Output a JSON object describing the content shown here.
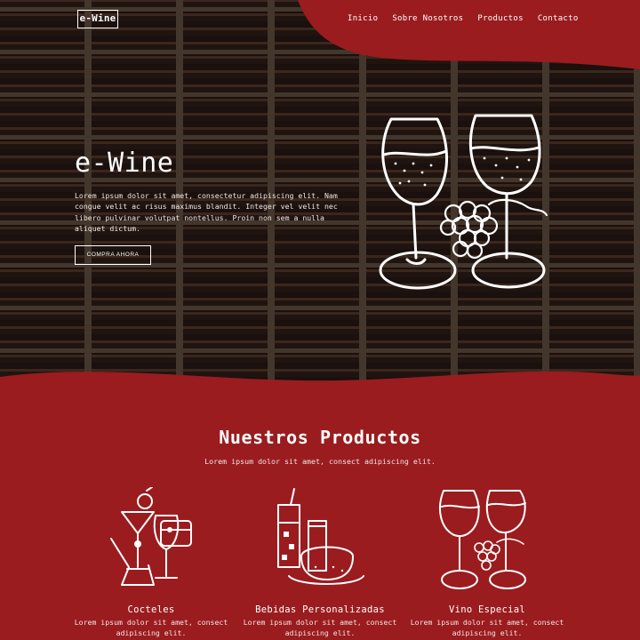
{
  "brand": {
    "logo": "e-Wine"
  },
  "nav": {
    "items": [
      "Inicio",
      "Sobre Nosotros",
      "Productos",
      "Contacto"
    ]
  },
  "hero": {
    "title": "e-Wine",
    "text": "Lorem ipsum dolor sit amet, consectetur adipiscing elit. Nam congue velit ac risus maximus blandit. Integer vel velit nec libero pulvinar volutpat nontellus. Proin non sem a nulla aliquet dictum.",
    "button": "COMPRA AHORA",
    "art_icon": "wine-glasses-grapes-icon"
  },
  "products": {
    "title": "Nuestros Productos",
    "subtitle": "Lorem ipsum dolor sit amet, consect adipiscing elit.",
    "items": [
      {
        "icon": "cocktails-icon",
        "title": "Cocteles",
        "text": "Lorem ipsum dolor sit amet, consect adipiscing elit."
      },
      {
        "icon": "custom-drinks-icon",
        "title": "Bebidas Personalizadas",
        "text": "Lorem ipsum dolor sit amet, consect adipiscing elit."
      },
      {
        "icon": "wine-glasses-icon",
        "title": "Vino Especial",
        "text": "Lorem ipsum dolor sit amet, consect adipiscing elit."
      }
    ]
  },
  "colors": {
    "accent": "#9a1c1f",
    "text": "#ffffff"
  }
}
